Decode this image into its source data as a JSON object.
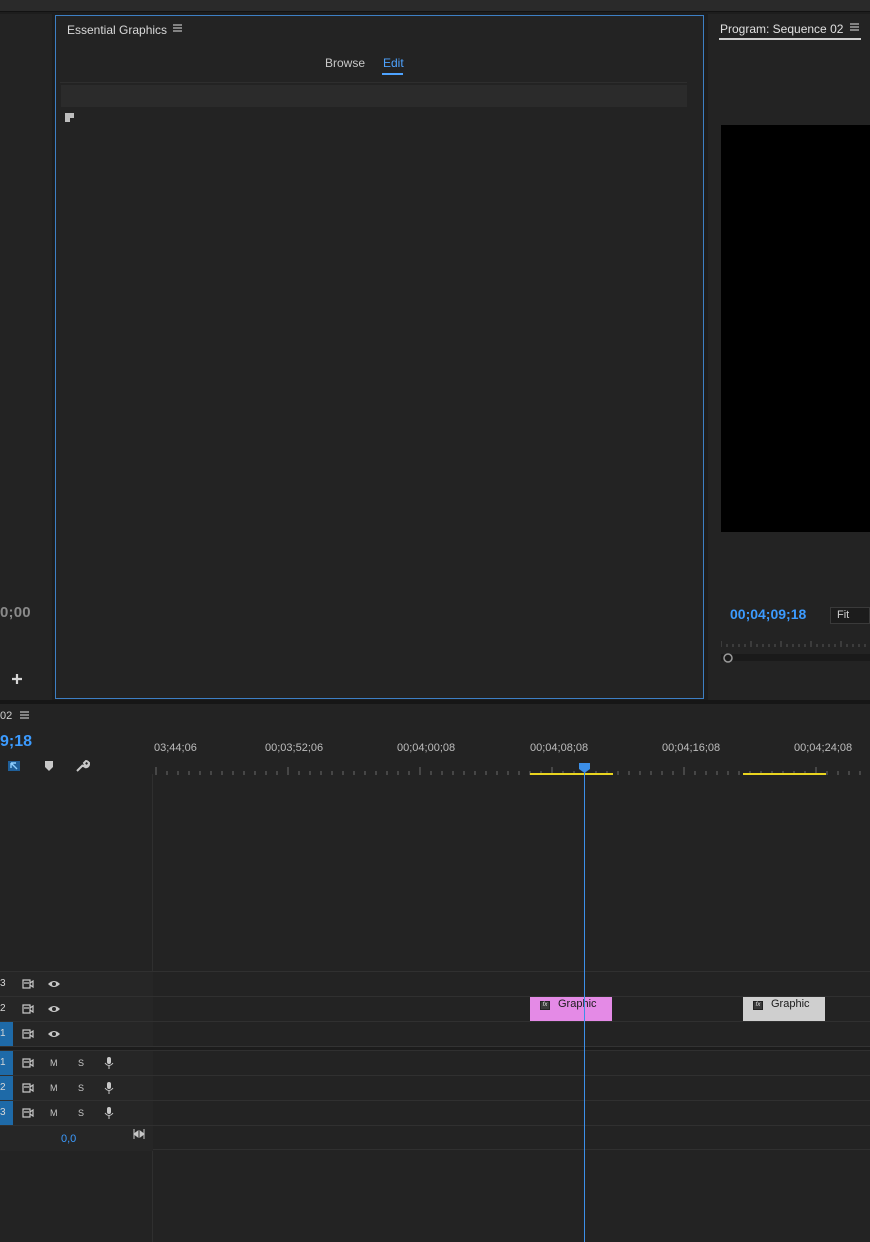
{
  "source_monitor": {
    "timecode": "0;00",
    "add_icon": "plus-icon"
  },
  "essential_graphics": {
    "title": "Essential Graphics",
    "menu_icon": "hamburger-icon",
    "tabs": [
      {
        "label": "Browse",
        "active": false
      },
      {
        "label": "Edit",
        "active": true
      }
    ]
  },
  "program_monitor": {
    "title": "Program: Sequence 02",
    "menu_icon": "hamburger-icon",
    "timecode": "00;04;09;18",
    "zoom": "Fit"
  },
  "timeline": {
    "title": "02",
    "menu_icon": "hamburger-icon",
    "timecode": "9;18",
    "tools": [
      "snap-icon",
      "marker-icon",
      "wrench-icon"
    ],
    "ruler_labels": [
      "03;44;06",
      "00;03;52;06",
      "00;04;00;08",
      "00;04;08;08",
      "00;04;16;08",
      "00;04;24;08"
    ],
    "video_tracks": [
      {
        "num": "3",
        "targeted": false
      },
      {
        "num": "2",
        "targeted": false
      },
      {
        "num": "1",
        "targeted": true
      }
    ],
    "audio_tracks": [
      {
        "num": "1",
        "targeted": true,
        "mute": "M",
        "solo": "S"
      },
      {
        "num": "2",
        "targeted": true,
        "mute": "M",
        "solo": "S"
      },
      {
        "num": "3",
        "targeted": true,
        "mute": "M",
        "solo": "S"
      }
    ],
    "master_volume": "0,0",
    "clips": [
      {
        "label": "Graphic",
        "track": "V2",
        "color": "#e48ae6"
      },
      {
        "label": "Graphic",
        "track": "V2",
        "color": "#cfcfcf"
      }
    ]
  },
  "colors": {
    "accent": "#3c9bff",
    "selection_border": "#3d7fc4",
    "in_out": "#e9d41f"
  }
}
